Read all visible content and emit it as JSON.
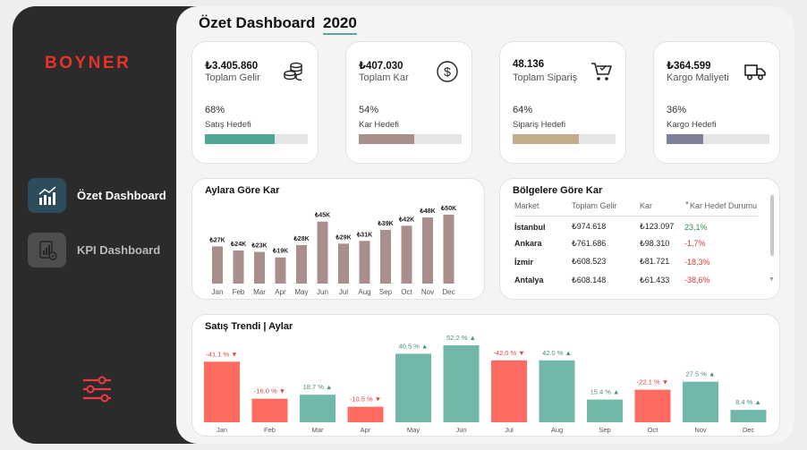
{
  "brand": {
    "logo_text": "BOYNER",
    "color": "#e5332a"
  },
  "nav": {
    "items": [
      {
        "label": "Özet Dashboard",
        "icon": "bar-chart-icon",
        "active": true
      },
      {
        "label": "KPI Dashboard",
        "icon": "kpi-report-icon",
        "active": false
      }
    ],
    "filter_icon": "sliders-icon"
  },
  "header": {
    "title": "Özet Dashboard",
    "year": "2020"
  },
  "kpis": [
    {
      "value": "₺3.405.860",
      "label": "Toplam Gelir",
      "percent": "68%",
      "target_label": "Satış Hedefi",
      "progress": 0.68,
      "color": "#4fa697",
      "icon": "coins-icon"
    },
    {
      "value": "₺407.030",
      "label": "Toplam Kar",
      "percent": "54%",
      "target_label": "Kar Hedefi",
      "progress": 0.54,
      "color": "#a88f8b",
      "icon": "dollar-circle-icon"
    },
    {
      "value": "48.136",
      "label": "Toplam Sipariş",
      "percent": "64%",
      "target_label": "Sipariş Hedefi",
      "progress": 0.64,
      "color": "#c1ac8b",
      "icon": "cart-icon"
    },
    {
      "value": "₺364.599",
      "label": "Kargo Maliyeti",
      "percent": "36%",
      "target_label": "Kargo Hedefi",
      "progress": 0.36,
      "color": "#7e7f99",
      "icon": "truck-icon"
    }
  ],
  "monthly_profit": {
    "title": "Aylara Göre Kar",
    "bar_color": "#a88f8b"
  },
  "regions": {
    "title": "Bölgelere Göre Kar",
    "columns": [
      "Market",
      "Toplam Gelir",
      "Kar",
      "Kar Hedef Durumu"
    ],
    "rows": [
      {
        "market": "İstanbul",
        "revenue": "₺974.618",
        "profit": "₺123.097",
        "target": "23,1%",
        "positive": true
      },
      {
        "market": "Ankara",
        "revenue": "₺761.686",
        "profit": "₺98.310",
        "target": "-1,7%",
        "positive": false
      },
      {
        "market": "İzmir",
        "revenue": "₺608.523",
        "profit": "₺81.721",
        "target": "-18,3%",
        "positive": false
      },
      {
        "market": "Antalya",
        "revenue": "₺608.148",
        "profit": "₺61.433",
        "target": "-38,6%",
        "positive": false
      }
    ]
  },
  "sales_trend": {
    "title": "Satış Trendi | Aylar",
    "up_color": "#72b8aa",
    "down_color": "#ff6b61"
  },
  "chart_data": [
    {
      "type": "bar",
      "title": "Aylara Göre Kar",
      "categories": [
        "Jan",
        "Feb",
        "Mar",
        "Apr",
        "May",
        "Jun",
        "Jul",
        "Aug",
        "Sep",
        "Oct",
        "Nov",
        "Dec"
      ],
      "values": [
        27,
        24,
        23,
        19,
        28,
        45,
        29,
        31,
        39,
        42,
        48,
        50
      ],
      "data_labels": [
        "₺27K",
        "₺24K",
        "₺23K",
        "₺19K",
        "₺28K",
        "₺45K",
        "₺29K",
        "₺31K",
        "₺39K",
        "₺42K",
        "₺48K",
        "₺50K"
      ],
      "unit": "₺K",
      "grid": false
    },
    {
      "type": "bar",
      "title": "Satış Trendi | Aylar",
      "categories": [
        "Jan",
        "Feb",
        "Mar",
        "Apr",
        "May",
        "Jun",
        "Jul",
        "Aug",
        "Sep",
        "Oct",
        "Nov",
        "Dec"
      ],
      "values": [
        -41.1,
        -16.0,
        18.7,
        -10.5,
        46.5,
        52.2,
        -42.0,
        42.0,
        15.4,
        -22.1,
        27.5,
        8.4
      ],
      "data_labels": [
        "-41.1 %",
        "-16.0 %",
        "18.7 %",
        "-10.5 %",
        "46.5 %",
        "52.2 %",
        "-42.0 %",
        "42.0 %",
        "15.4 %",
        "-22.1 %",
        "27.5 %",
        "8.4 %"
      ],
      "unit": "%",
      "grid": false
    }
  ]
}
